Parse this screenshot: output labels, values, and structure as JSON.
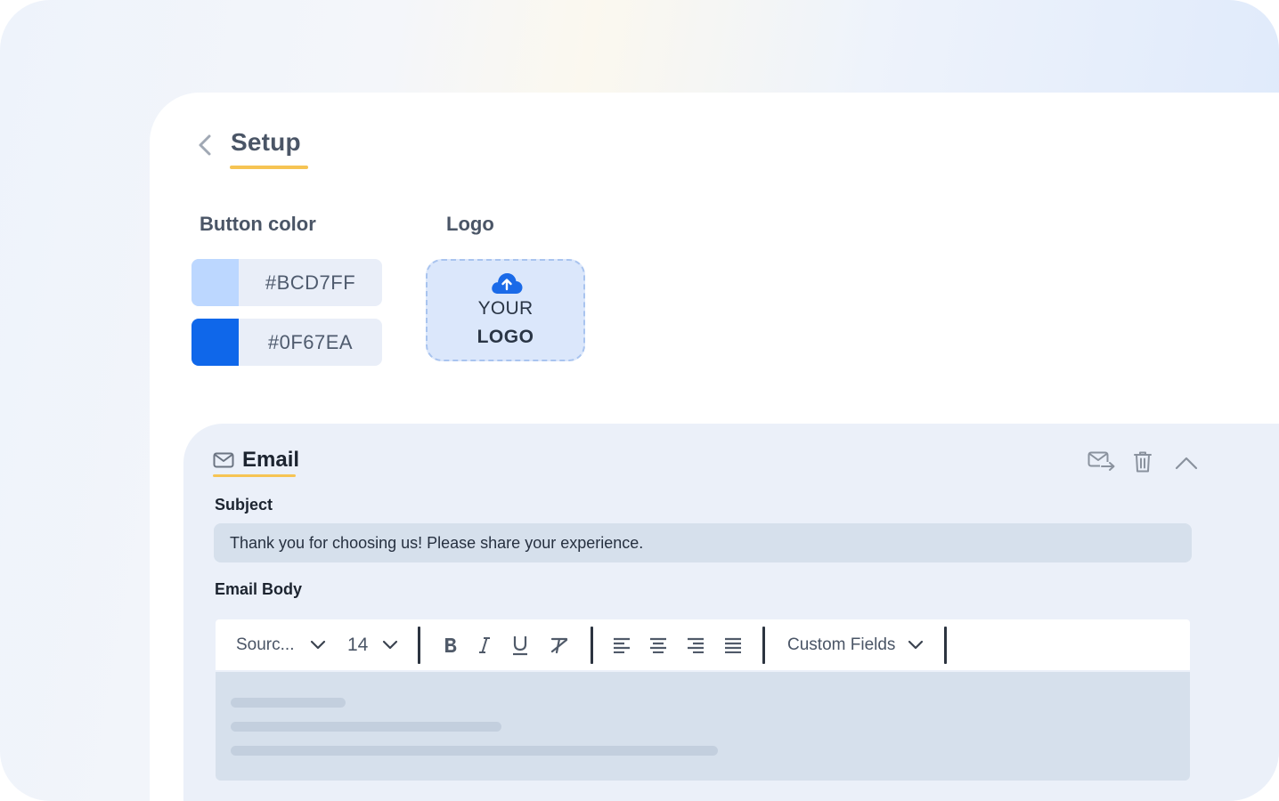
{
  "header": {
    "title": "Setup",
    "back_icon": "chevron-left-icon"
  },
  "button_color": {
    "label": "Button color",
    "swatches": [
      {
        "hex": "#BCD7FF",
        "color": "#BCD7FF"
      },
      {
        "hex": "#0F67EA",
        "color": "#0F67EA"
      }
    ]
  },
  "logo": {
    "label": "Logo",
    "upload_icon": "cloud-upload-icon",
    "line1": "YOUR",
    "line2": "LOGO"
  },
  "email": {
    "title": "Email",
    "icon": "envelope-icon",
    "actions": {
      "send_icon": "send-mail-icon",
      "delete_icon": "trash-icon",
      "collapse_icon": "chevron-up-icon"
    },
    "subject_label": "Subject",
    "subject_value": "Thank you for choosing us! Please share your experience.",
    "body_label": "Email Body",
    "toolbar": {
      "font_family": "Sourc...",
      "font_size": "14",
      "custom_fields": "Custom Fields"
    }
  },
  "colors": {
    "accent_underline": "#F6C453",
    "primary_blue": "#0F67EA",
    "light_blue": "#BCD7FF"
  }
}
